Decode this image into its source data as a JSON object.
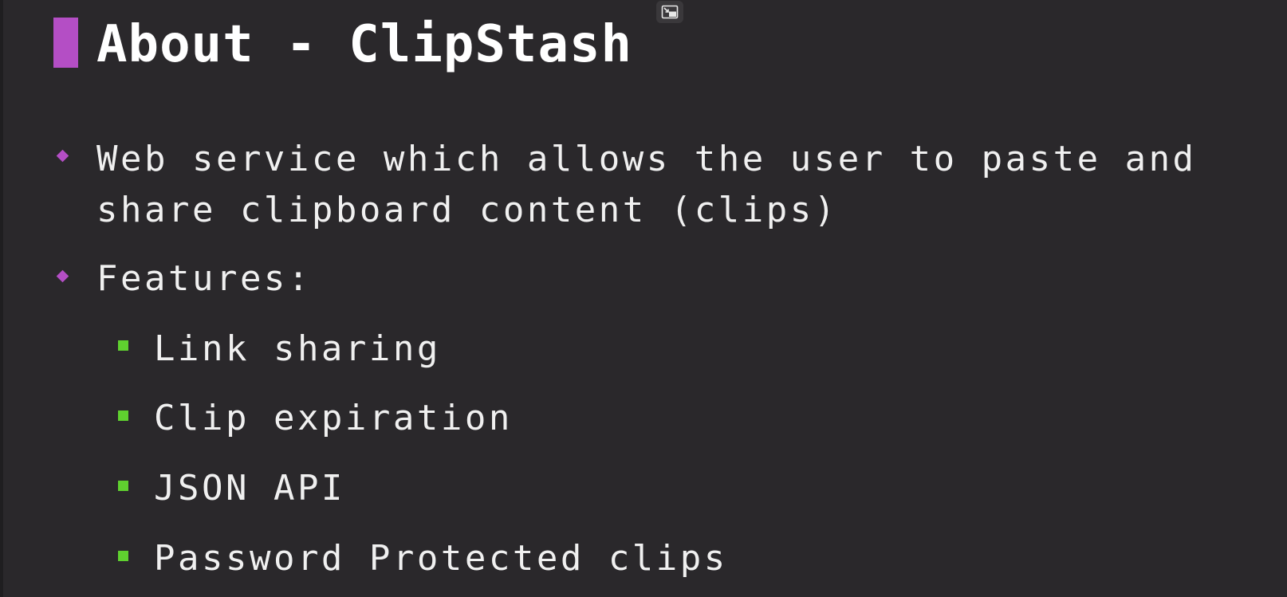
{
  "slide": {
    "title": "About - ClipStash",
    "bullets": [
      {
        "line1": "Web service which allows the user to paste and",
        "line2": "share clipboard content (clips)"
      },
      {
        "line1": "Features:"
      }
    ],
    "features": [
      "Link sharing",
      "Clip expiration",
      "JSON API",
      "Password Protected clips"
    ]
  },
  "colors": {
    "background": "#2a282b",
    "accent_purple": "#b44ec5",
    "accent_green": "#5fd12f",
    "text": "#f0f0f0"
  },
  "icons": {
    "overlay_button": "picture-in-picture-exit-icon"
  }
}
